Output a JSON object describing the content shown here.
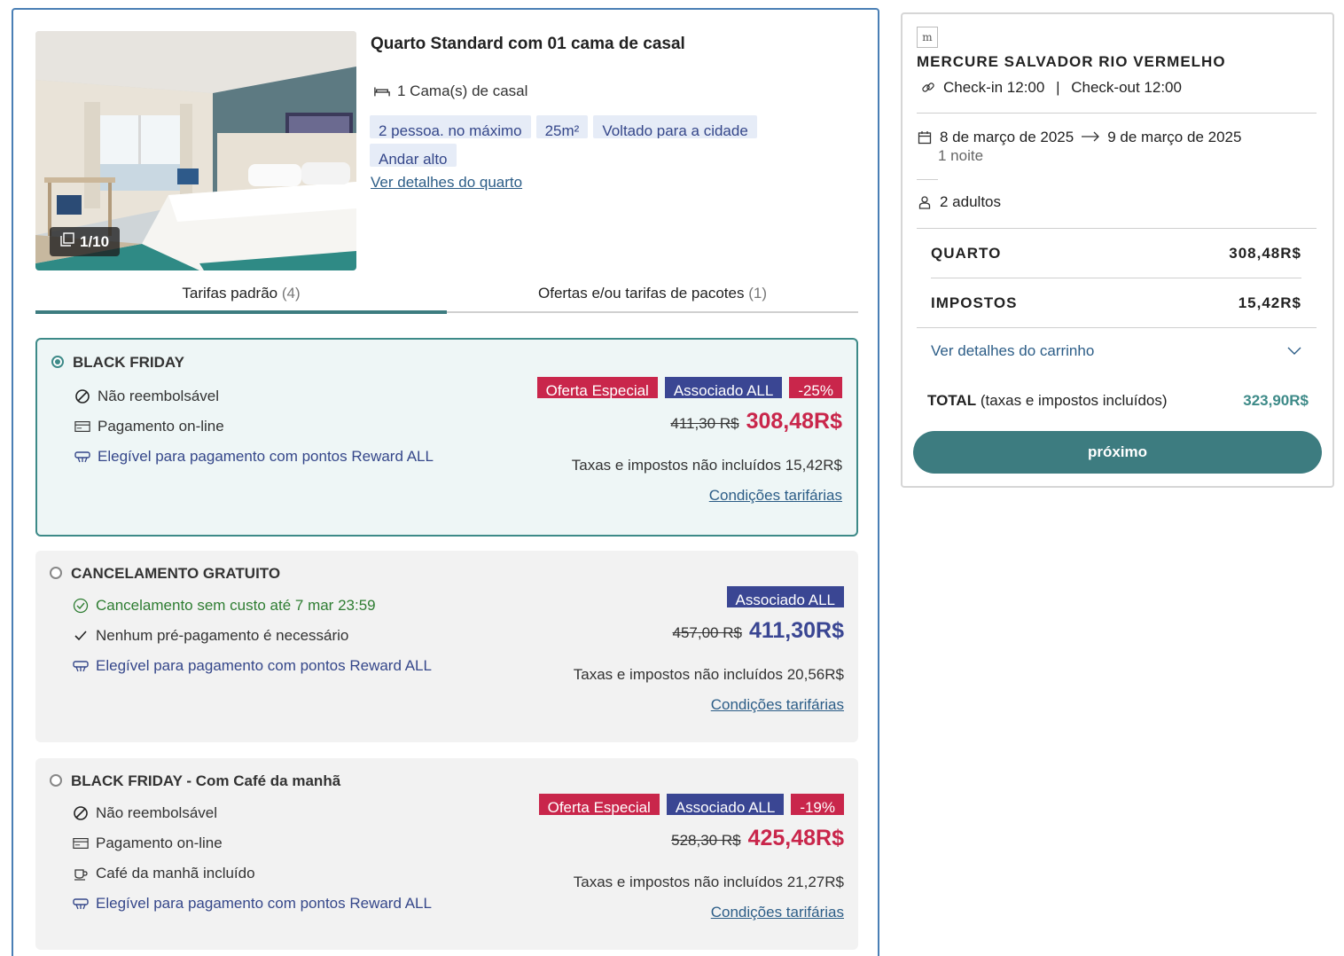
{
  "room": {
    "title": "Quarto Standard com 01 cama de casal",
    "photo_counter": "1/10",
    "bed": "1 Cama(s) de casal",
    "tags": [
      "2 pessoa. no máximo",
      "25m²",
      "Voltado para a cidade",
      "Andar alto"
    ],
    "details_link": "Ver detalhes do quarto"
  },
  "tabs": [
    {
      "label": "Tarifas padrão",
      "count": "(4)"
    },
    {
      "label": "Ofertas e/ou tarifas de pacotes",
      "count": "(1)"
    }
  ],
  "rates": [
    {
      "name": "BLACK FRIDAY",
      "features": [
        "Não reembolsável",
        "Pagamento on-line",
        "Elegível para pagamento com pontos Reward ALL"
      ],
      "badges": [
        "Oferta Especial",
        "Associado ALL",
        "-25%"
      ],
      "old_price": "411,30 R$",
      "price": "308,48R$",
      "tax": "Taxas e impostos não incluídos 15,42R$",
      "conditions": "Condições tarifárias"
    },
    {
      "name": "CANCELAMENTO GRATUITO",
      "features": [
        "Cancelamento sem custo até 7 mar 23:59",
        "Nenhum pré-pagamento é necessário",
        "Elegível para pagamento com pontos Reward ALL"
      ],
      "badges": [
        "Associado ALL"
      ],
      "old_price": "457,00 R$",
      "price": "411,30R$",
      "tax": "Taxas e impostos não incluídos 20,56R$",
      "conditions": "Condições tarifárias"
    },
    {
      "name": "BLACK FRIDAY - Com Café da manhã",
      "features": [
        "Não reembolsável",
        "Pagamento on-line",
        "Café da manhã incluído",
        "Elegível para pagamento com pontos Reward ALL"
      ],
      "badges": [
        "Oferta Especial",
        "Associado ALL",
        "-19%"
      ],
      "old_price": "528,30 R$",
      "price": "425,48R$",
      "tax": "Taxas e impostos não incluídos 21,27R$",
      "conditions": "Condições tarifárias"
    }
  ],
  "summary": {
    "hotel_name": "MERCURE SALVADOR RIO VERMELHO",
    "checkin": "Check-in 12:00",
    "checkout": "Check-out 12:00",
    "date_from": "8 de março de 2025",
    "date_to": "9 de março de 2025",
    "nights": "1 noite",
    "guests": "2 adultos",
    "room_label": "QUARTO",
    "room_value": "308,48R$",
    "tax_label": "IMPOSTOS",
    "tax_value": "15,42R$",
    "cart_link": "Ver detalhes do carrinho",
    "total_label": "TOTAL",
    "total_note": "(taxas e impostos incluídos)",
    "total_value": "323,90R$",
    "next_button": "próximo"
  },
  "colors": {
    "teal": "#3d7c80",
    "red": "#c9264b",
    "navy": "#3a4693",
    "link": "#2c5d87"
  }
}
